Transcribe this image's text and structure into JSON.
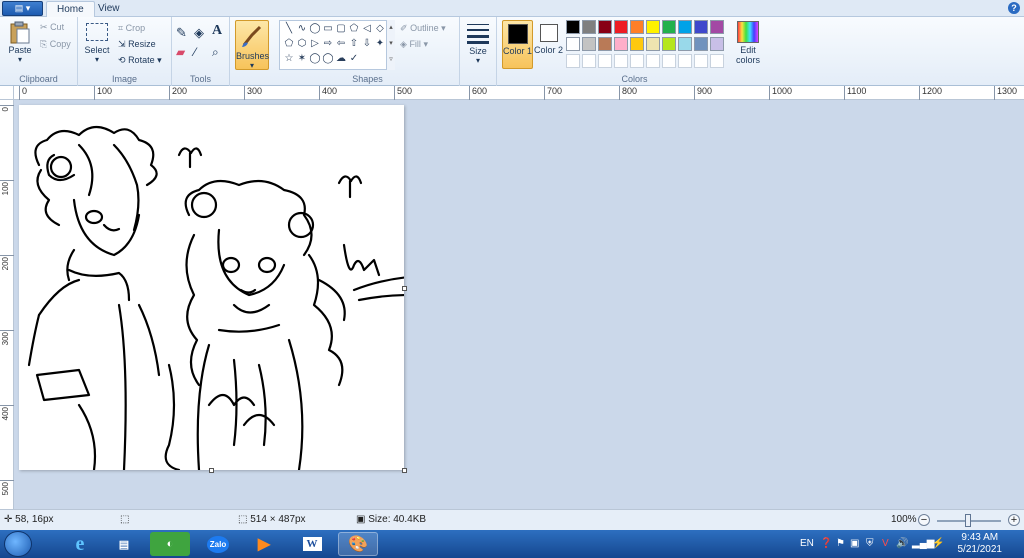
{
  "ribbon_tabs": [
    "Home",
    "View"
  ],
  "clipboard": {
    "paste": "Paste",
    "cut": "Cut",
    "copy": "Copy",
    "label": "Clipboard"
  },
  "image": {
    "select": "Select",
    "crop": "Crop",
    "resize": "Resize",
    "rotate": "Rotate",
    "label": "Image"
  },
  "tools": {
    "label": "Tools",
    "brushes": "Brushes"
  },
  "shapes": {
    "label": "Shapes",
    "outline": "Outline",
    "fill": "Fill",
    "glyphs": [
      "╲",
      "∿",
      "◯",
      "▭",
      "▢",
      "⬠",
      "◁",
      "◇",
      "⬠",
      "⬡",
      "▷",
      "⇨",
      "⇦",
      "⇧",
      "⇩",
      "✦",
      "☆",
      "✶",
      "◯",
      "◯",
      "☁",
      "✓"
    ]
  },
  "size": {
    "label": "Size"
  },
  "colors": {
    "label": "Colors",
    "color1": "Color 1",
    "color2": "Color 2",
    "edit": "Edit colors",
    "color1_value": "#000000",
    "color2_value": "#ffffff",
    "palette_row1": [
      "#000000",
      "#7f7f7f",
      "#880015",
      "#ed1c24",
      "#ff7f27",
      "#fff200",
      "#22b14c",
      "#00a2e8",
      "#3f48cc",
      "#a349a4"
    ],
    "palette_row2": [
      "#ffffff",
      "#c3c3c3",
      "#b97a57",
      "#ffaec9",
      "#ffc90e",
      "#efe4b0",
      "#b5e61d",
      "#99d9ea",
      "#7092be",
      "#c8bfe7"
    ],
    "palette_row3": [
      "#ffffff",
      "#ffffff",
      "#ffffff",
      "#ffffff",
      "#ffffff",
      "#ffffff",
      "#ffffff",
      "#ffffff",
      "#ffffff",
      "#ffffff"
    ]
  },
  "ruler_h": [
    "0",
    "100",
    "200",
    "300",
    "400",
    "500",
    "600",
    "700",
    "800",
    "900",
    "1000",
    "1100",
    "1200",
    "1300"
  ],
  "ruler_v": [
    "0",
    "100",
    "200",
    "300",
    "400",
    "500"
  ],
  "status": {
    "cursor": "58, 16px",
    "dimensions": "514 × 487px",
    "filesize": "Size: 40.4KB",
    "zoom": "100%"
  },
  "taskbar": {
    "apps": [
      "e",
      "zalo",
      "W"
    ],
    "zalo_label": "Zalo",
    "lang": "EN",
    "time": "9:43 AM",
    "date": "5/21/2021"
  }
}
